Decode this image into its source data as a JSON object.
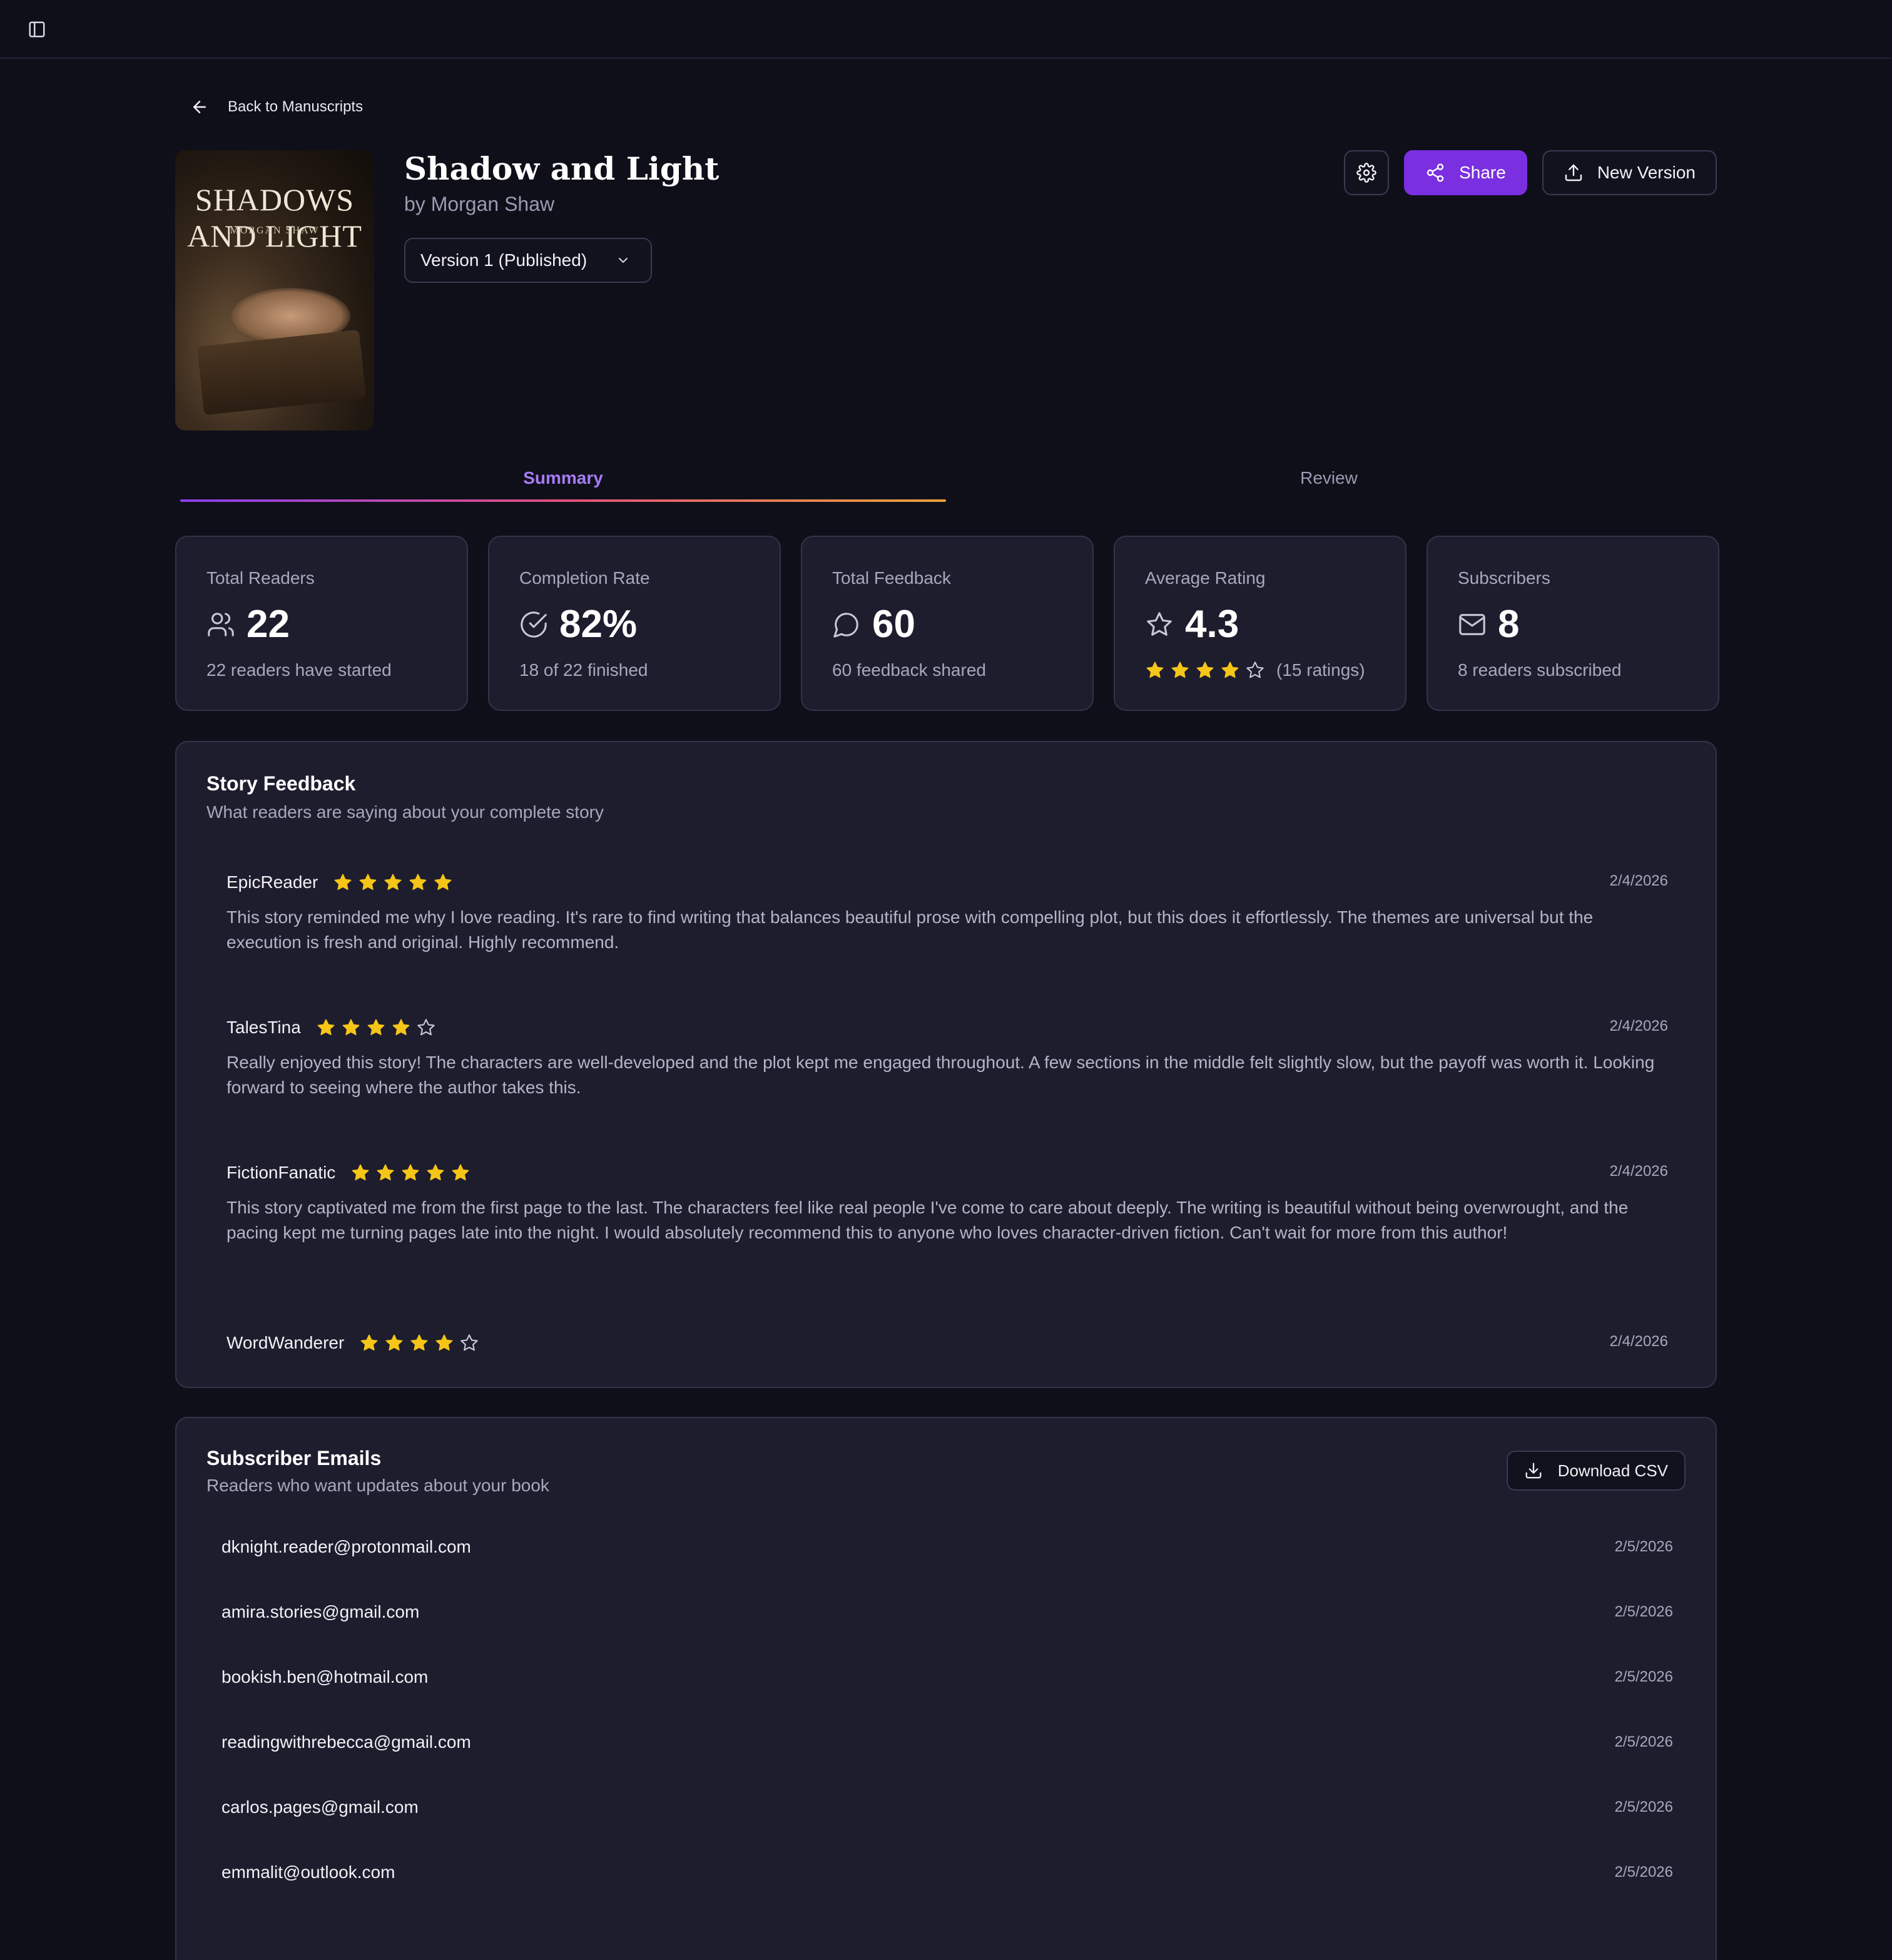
{
  "nav": {
    "back_label": "Back to Manuscripts"
  },
  "book": {
    "title": "Shadow and Light",
    "author": "by Morgan Shaw",
    "cover_title": "SHADOWS AND LIGHT",
    "cover_author": "MORGAN SHAW",
    "version": "Version 1 (Published)"
  },
  "actions": {
    "share_label": "Share",
    "new_version_label": "New Version"
  },
  "tabs": [
    {
      "label": "Summary",
      "active": true
    },
    {
      "label": "Review",
      "active": false
    }
  ],
  "stats": [
    {
      "label": "Total Readers",
      "icon": "users-icon",
      "value": "22",
      "sub": "22 readers have started"
    },
    {
      "label": "Completion Rate",
      "icon": "check-circle-icon",
      "value": "82%",
      "sub": "18 of 22 finished"
    },
    {
      "label": "Total Feedback",
      "icon": "message-icon",
      "value": "60",
      "sub": "60 feedback shared"
    },
    {
      "label": "Average Rating",
      "icon": "star-icon",
      "value": "4.3",
      "sub": "(15 ratings)",
      "stars": 4
    },
    {
      "label": "Subscribers",
      "icon": "mail-icon",
      "value": "8",
      "sub": "8 readers subscribed"
    }
  ],
  "feedback": {
    "title": "Story Feedback",
    "subtitle": "What readers are saying about your complete story",
    "reviews": [
      {
        "name": "EpicReader",
        "rating": 5,
        "date": "2/4/2026",
        "text": "This story reminded me why I love reading. It's rare to find writing that balances beautiful prose with compelling plot, but this does it effortlessly. The themes are universal but the execution is fresh and original. Highly recommend."
      },
      {
        "name": "TalesTina",
        "rating": 4,
        "date": "2/4/2026",
        "text": "Really enjoyed this story! The characters are well-developed and the plot kept me engaged throughout. A few sections in the middle felt slightly slow, but the payoff was worth it. Looking forward to seeing where the author takes this."
      },
      {
        "name": "FictionFanatic",
        "rating": 5,
        "date": "2/4/2026",
        "text": "This story captivated me from the first page to the last. The characters feel like real people I've come to care about deeply. The writing is beautiful without being overwrought, and the pacing kept me turning pages late into the night. I would absolutely recommend this to anyone who loves character-driven fiction. Can't wait for more from this author!"
      },
      {
        "name": "WordWanderer",
        "rating": 4,
        "date": "2/4/2026",
        "text": ""
      }
    ]
  },
  "subscribers": {
    "title": "Subscriber Emails",
    "subtitle": "Readers who want updates about your book",
    "download_label": "Download CSV",
    "emails": [
      {
        "email": "dknight.reader@protonmail.com",
        "date": "2/5/2026"
      },
      {
        "email": "amira.stories@gmail.com",
        "date": "2/5/2026"
      },
      {
        "email": "bookish.ben@hotmail.com",
        "date": "2/5/2026"
      },
      {
        "email": "readingwithrebecca@gmail.com",
        "date": "2/5/2026"
      },
      {
        "email": "carlos.pages@gmail.com",
        "date": "2/5/2026"
      },
      {
        "email": "emmalit@outlook.com",
        "date": "2/5/2026"
      }
    ]
  },
  "colors": {
    "accent": "#7a2fe0",
    "tab_active": "#a77cf5",
    "star": "#f5c518"
  }
}
